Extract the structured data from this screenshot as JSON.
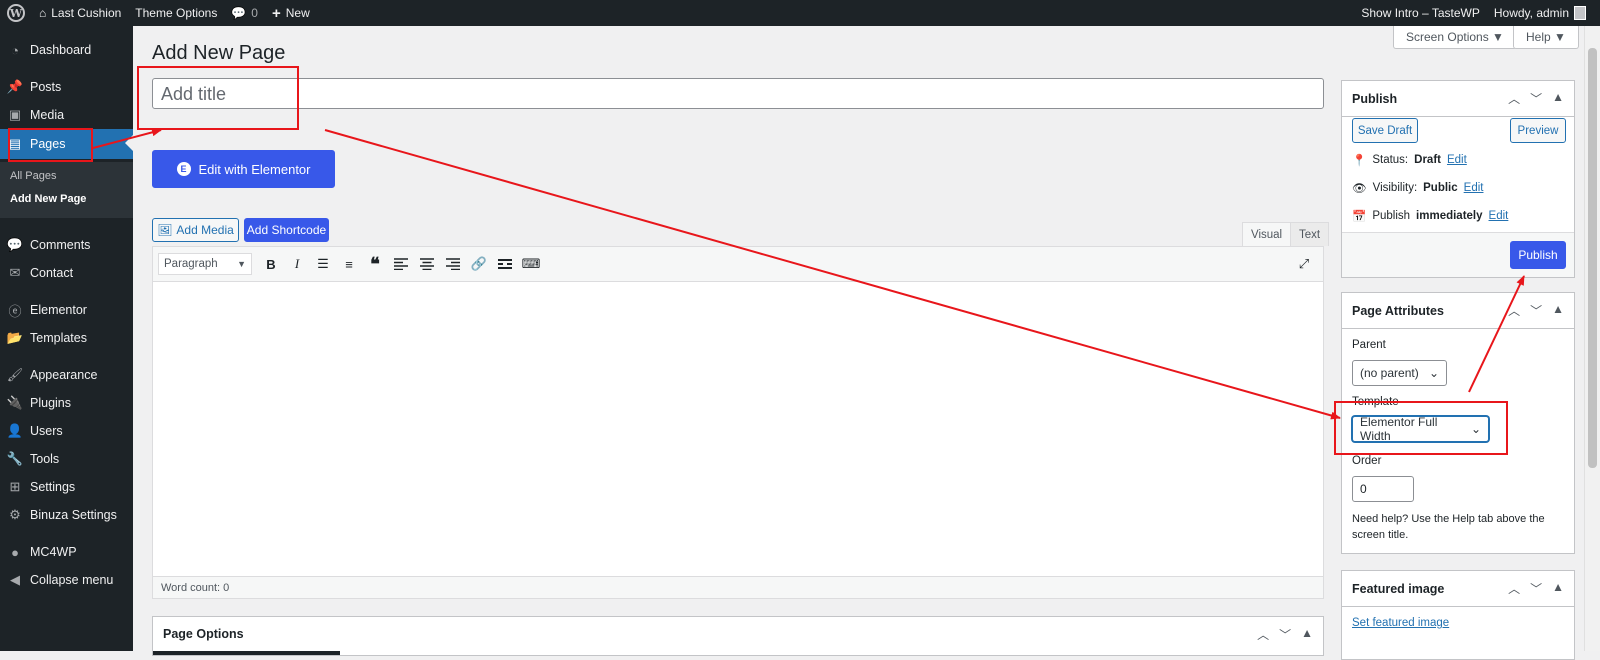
{
  "adminbar": {
    "site_name": "Last Cushion",
    "theme_options": "Theme Options",
    "comments_count": "0",
    "new_label": "New",
    "show_intro": "Show Intro – TasteWP",
    "howdy": "Howdy, admin"
  },
  "sidebar": {
    "dashboard": "Dashboard",
    "posts": "Posts",
    "media": "Media",
    "pages": "Pages",
    "all_pages": "All Pages",
    "add_new_page": "Add New Page",
    "comments": "Comments",
    "contact": "Contact",
    "elementor": "Elementor",
    "templates": "Templates",
    "appearance": "Appearance",
    "plugins": "Plugins",
    "users": "Users",
    "tools": "Tools",
    "settings": "Settings",
    "binuza": "Binuza Settings",
    "mc4wp": "MC4WP",
    "collapse": "Collapse menu"
  },
  "screen_options": "Screen Options ▼",
  "help": "Help ▼",
  "page_title": "Add New Page",
  "title_placeholder": "Add title",
  "edit_elementor": "Edit with Elementor",
  "editor": {
    "add_media": "Add Media",
    "add_shortcode": "Add Shortcode",
    "tab_visual": "Visual",
    "tab_text": "Text",
    "format": "Paragraph",
    "word_count": "Word count: 0"
  },
  "publish_box": {
    "title": "Publish",
    "save_draft": "Save Draft",
    "preview": "Preview",
    "status_label": "Status:",
    "status_value": "Draft",
    "visibility_label": "Visibility:",
    "visibility_value": "Public",
    "publish_label": "Publish",
    "publish_value": "immediately",
    "edit": "Edit",
    "publish_button": "Publish"
  },
  "attributes_box": {
    "title": "Page Attributes",
    "parent_label": "Parent",
    "parent_value": "(no parent)",
    "template_label": "Template",
    "template_value": "Elementor Full Width",
    "order_label": "Order",
    "order_value": "0",
    "help_text": "Need help? Use the Help tab above the screen title."
  },
  "featured_box": {
    "title": "Featured image",
    "link": "Set featured image"
  },
  "page_options": {
    "title": "Page Options"
  },
  "colors": {
    "admin_dark": "#1d2327",
    "wp_blue": "#2271b1",
    "elementor_blue": "#3858e9",
    "annotation_red": "#e8161b"
  }
}
